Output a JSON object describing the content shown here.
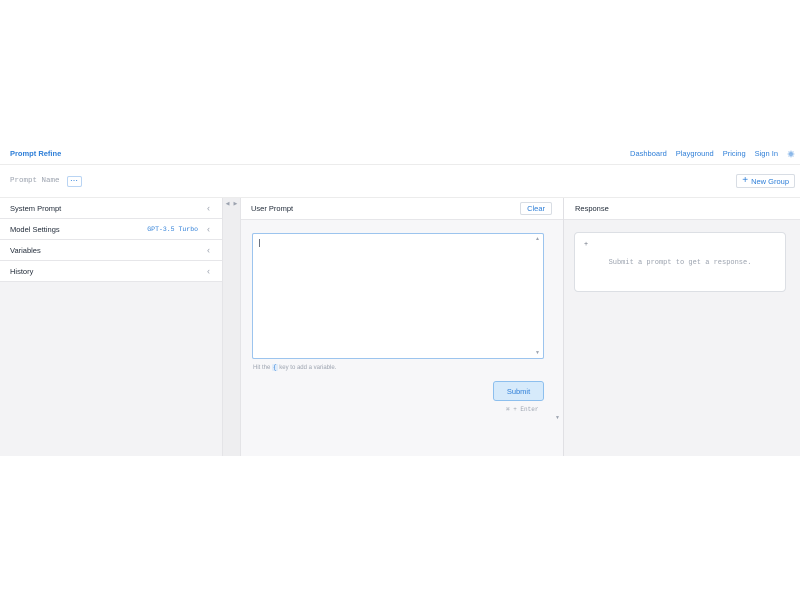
{
  "app": {
    "title": "Prompt Refine"
  },
  "nav": {
    "items": [
      "Dashboard",
      "Playground",
      "Pricing",
      "Sign In"
    ],
    "settings_icon": "gear-icon"
  },
  "toolbar": {
    "prompt_name": "Prompt Name",
    "more_label": "⋯",
    "new_group_icon": "+",
    "new_group_label": "New Group"
  },
  "sidebar": {
    "items": [
      {
        "label": "System Prompt",
        "value": ""
      },
      {
        "label": "Model Settings",
        "value": "GPT-3.5 Turbo"
      },
      {
        "label": "Variables",
        "value": ""
      },
      {
        "label": "History",
        "value": ""
      }
    ],
    "chevron": "‹"
  },
  "user_prompt": {
    "title": "User Prompt",
    "clear_label": "Clear",
    "value": "",
    "hint_before": "Hit the",
    "hint_key": "{",
    "hint_after": "key to add a variable.",
    "submit_label": "Submit",
    "shortcut": "⌘ + Enter"
  },
  "response": {
    "title": "Response",
    "icon": "+",
    "placeholder": "Submit a prompt to get a response."
  },
  "colors": {
    "accent": "#2f7fd8",
    "submit_bg": "#d6eafb",
    "panel_bg": "#f3f3f5"
  }
}
